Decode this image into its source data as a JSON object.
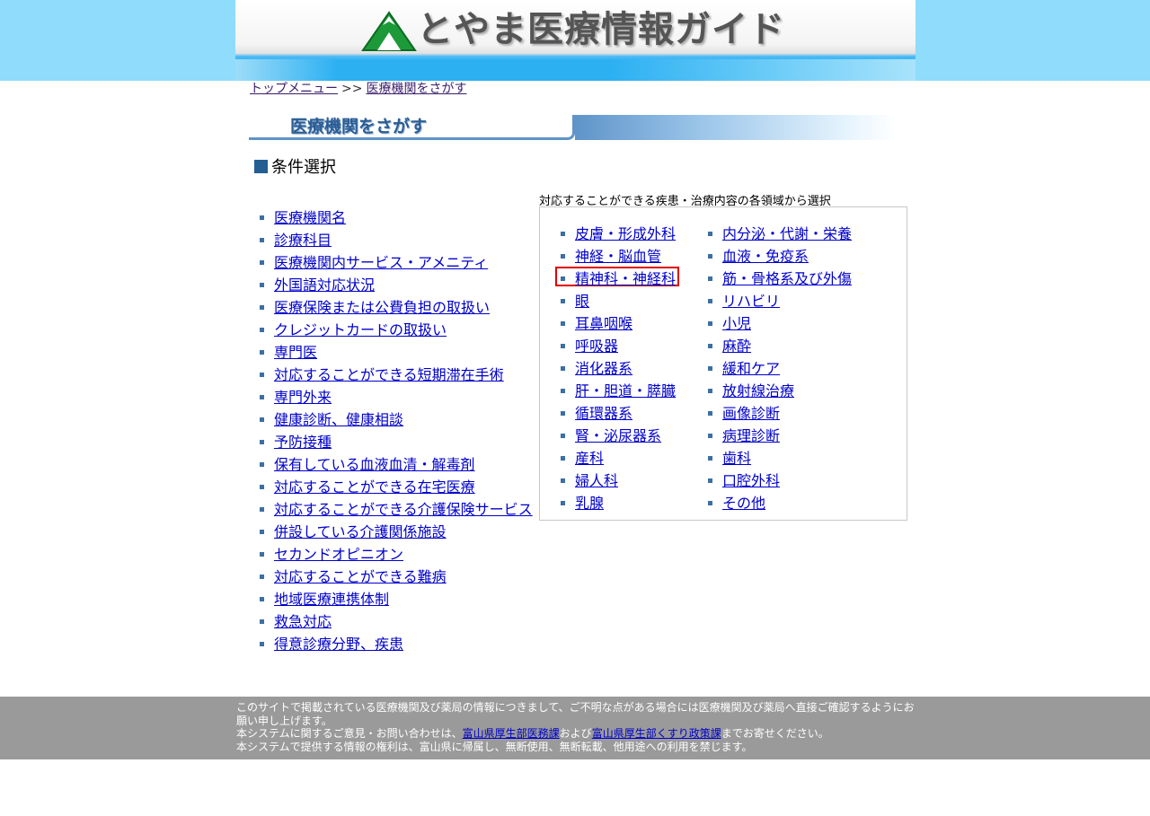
{
  "header": {
    "logo_icon": "mountain-logo-icon",
    "title": "とやま医療情報ガイド",
    "colors": {
      "band": "#8fdcfd",
      "bar": "#2cb0f2",
      "logo": "#1c9a3a"
    }
  },
  "breadcrumb": {
    "home": "トップメニュー",
    "separator": ">>",
    "current": "医療機関をさがす"
  },
  "banner": {
    "title": "医療機関をさがす"
  },
  "conditions": {
    "heading": "条件選択"
  },
  "left_list": [
    "医療機関名",
    "診療科目",
    "医療機関内サービス・アメニティ",
    "外国語対応状況",
    "医療保険または公費負担の取扱い",
    "クレジットカードの取扱い",
    "専門医",
    "対応することができる短期滞在手術",
    "専門外来",
    "健康診断、健康相談",
    "予防接種",
    "保有している血液血清・解毒剤",
    "対応することができる在宅医療",
    "対応することができる介護保険サービス",
    "併設している介護関係施設",
    "セカンドオピニオン",
    "対応することができる難病",
    "地域医療連携体制",
    "救急対応",
    "得意診療分野、疾患"
  ],
  "panel": {
    "caption": "対応することができる疾患・治療内容の各領域から選択",
    "col1": [
      "皮膚・形成外科",
      "神経・脳血管",
      "精神科・神経科",
      "眼",
      "耳鼻咽喉",
      "呼吸器",
      "消化器系",
      "肝・胆道・膵臓",
      "循環器系",
      "腎・泌尿器系",
      "産科",
      "婦人科",
      "乳腺"
    ],
    "col2": [
      "内分泌・代謝・栄養",
      "血液・免疫系",
      "筋・骨格系及び外傷",
      "リハビリ",
      "小児",
      "麻酔",
      "緩和ケア",
      "放射線治療",
      "画像診断",
      "病理診断",
      "歯科",
      "口腔外科",
      "その他"
    ],
    "highlighted": "精神科・神経科",
    "highlight_color": "#e00000"
  },
  "footer": {
    "line1": "このサイトで掲載されている医療機関及び薬局の情報につきまして、ご不明な点がある場合には医療機関及び薬局へ直接ご確認するようにお願い申し上げます。",
    "line2_pre": "本システムに関するご意見・お問い合わせは、",
    "link1": "富山県厚生部医務課",
    "line2_mid": "および",
    "link2": "富山県厚生部くすり政策課",
    "line2_post": "までお寄せください。",
    "line3": "本システムで提供する情報の権利は、富山県に帰属し、無断使用、無断転載、他用途への利用を禁じます。"
  }
}
